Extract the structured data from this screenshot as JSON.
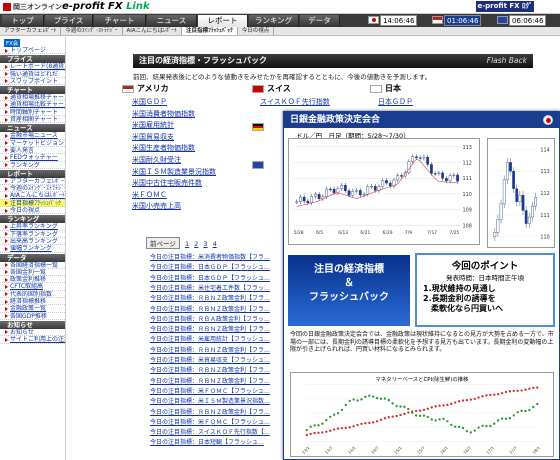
{
  "header": {
    "company": "岡三オンライン",
    "brand_prefix": "e-profit FX ",
    "brand_suffix": "Link",
    "clock1": "14:06:46",
    "clock2": "01:06:46",
    "clock3": "06:06:46",
    "fx_link": "e-profit FX ﾛｸﾞｱｳﾄ"
  },
  "nav": [
    "トップ",
    "プライス",
    "チャート",
    "ニュース",
    "レポート",
    "ランキング",
    "データ"
  ],
  "active_tab": "レポート",
  "subnav": [
    "アフターカフェﾚﾎﾟｰﾄ",
    "今週のｽｲﾝｸﾞ･ｽﾄﾗﾃｼﾞｰ",
    "AIAこんにちはﾚﾎﾟｰﾄ",
    "注目指標ﾌﾗｯｼｭﾊﾞｯｸ",
    "今日の視点"
  ],
  "sidebar": {
    "logo_text": "FX会",
    "sections": [
      {
        "title": "",
        "items": [
          "トップページ"
        ]
      },
      {
        "title": "プライス",
        "items": [
          "レートボード(8通貨)",
          "強い通貨はどれだ",
          "スワップポイント"
        ]
      },
      {
        "title": "チャート",
        "items": [
          "通貨相場推移チャート",
          "通貨相場比較チャート",
          "時間軸別チャート",
          "資産相関チャート"
        ]
      },
      {
        "title": "ニュース",
        "items": [
          "金融市場ニュース",
          "マーケットビジョン",
          "要人発言",
          "FEDウォッチャー",
          "ランキング"
        ]
      },
      {
        "title": "レポート",
        "items": [
          "アフターカフェﾚﾎﾟｰﾄ",
          "今週のｽｲﾝｸﾞ･ｽﾄﾗﾃｼﾞｰ",
          "AIAこんにちはﾚﾎﾟｰﾄ",
          "注目指標ﾌﾗｯｼｭﾊﾞｯｸ",
          "今日の視点"
        ]
      },
      {
        "title": "ランキング",
        "items": [
          "上昇率ランキング",
          "下落率ランキング",
          "出来高ランキング",
          "値幅ランキング"
        ]
      },
      {
        "title": "データ",
        "items": [
          "各国経済指標一覧",
          "各国金利一覧",
          "政策金利推移",
          "CFTC取組高",
          "代表的国別指数",
          "経済指標推移",
          "金融政策一覧",
          "各国GDP推移"
        ]
      },
      {
        "title": "お知らせ",
        "items": [
          "お知らせ",
          "サイトご利用上の注意"
        ]
      }
    ],
    "highlighted": "注目指標ﾌﾗｯｼｭﾊﾞｯｸ"
  },
  "main": {
    "title": "注目の経済指標・フラッシュバック",
    "title_right": "Flash Back",
    "description": "前回、結果発表後にどのような値動きをみせたかを再確認するとともに、今後の値動きを予測します。",
    "countries": [
      {
        "name": "アメリカ",
        "items": [
          "米国ＧＤＰ",
          "米国消費者物価指数",
          "米国雇用統計",
          "米国貿易収支",
          "米国生産者物価指数",
          "米国耐久財受注",
          "米国ＩＳＭ製造業景況指数",
          "米国中古住宅販売件数",
          "米ＦＯＭＣ",
          "米国小売売上高"
        ]
      },
      {
        "name": "スイス",
        "items": [
          "スイスＫＯＦ先行指数"
        ]
      },
      {
        "name": "日本",
        "items": [
          "日本ＧＤＰ",
          "日本短観"
        ]
      }
    ],
    "pager": {
      "prev": "前ページ",
      "pages": [
        "1",
        "2",
        "3",
        "4"
      ]
    },
    "archive": [
      "今日の注目指標：米消費者物価指数【フラ…",
      "今日の注目指標：日本ＧＤＰ【フラッシュ…",
      "今日の注目指標：日本ＧＤＰ【フラッシュ…",
      "今日の注目指標：米住宅着工件数【フラッ…",
      "今日の注目指標：ＲＢＮＺ政策金利【フラ…",
      "今日の注目指標：ＲＢＮＺ政策金利【フラ…",
      "今日の注目指標：ＲＢＡ政策金利【フラッ…",
      "今日の注目指標：ＲＢＮＺ政策金利【フラ…",
      "今日の注目指標：米雇用統計【フラッシュ…",
      "今日の注目指標：ＲＢＮＺ政策金利【フラ…",
      "今日の注目指標：米貿易収支【フラッシュ…",
      "今日の注目指標：ＲＢＮＺ政策金利【フラ…",
      "今日の注目指標：ＲＢＮＺ政策金利【フラ…",
      "今日の注目指標：米ＦＯＭＣ【フラッシュ…",
      "今日の注目指標：米ＩＳＭ製造業景況指数…",
      "今日の注目指標：ＲＢＮＺ政策金利【フラ…",
      "今日の注目指標：米ＦＯＭＣ【フラッシュ…",
      "今日の注目指標：スイスＫＯＦ先行指数【…",
      "今日の注目指標：日本短観【フラッシュ…"
    ]
  },
  "popup": {
    "title": "日銀金融政策決定会合",
    "subtitle": "ドル／円　日足（期間：5/28～7/30）",
    "banner": [
      "注目の経済指標",
      "＆",
      "フラッシュバック"
    ],
    "point_title": "今回のポイント",
    "point_sub": "発表時間：日本時間正午頃",
    "points": [
      "1.現状維持の見通し",
      "2.長期金利の誘導を",
      "　柔軟化なら円買いへ"
    ],
    "body": "今回の日銀金融政策決定会合では、金融政策は現状維持になるとの見方が大勢を占める一方で、市場の一部には、長期金利の誘導目標の柔軟化を予想する見方も出ています。長期金利の変動幅の上限が引き上げられれば、円買い材料になるとみられます。",
    "chart3_title": "マネタリーベースとCPI(除生鮮)の推移",
    "chart1_ylabels": [
      "113",
      "112",
      "111",
      "110",
      "109",
      "108"
    ],
    "chart1_xlabels": [
      "5/28",
      "6/5",
      "6/13",
      "6/21",
      "6/29",
      "7/9",
      "7/17",
      "7/25"
    ],
    "chart2_ylabels": [
      "114",
      "113",
      "112",
      "111",
      "110"
    ],
    "chart3_xlabels": [
      "13/1",
      "13/7",
      "14/1",
      "14/7",
      "15/1",
      "15/7",
      "16/1",
      "16/7",
      "17/1",
      "17/7",
      "18/1"
    ]
  },
  "chart_data": [
    {
      "type": "line",
      "title": "",
      "x": [
        "5/28",
        "6/5",
        "6/13",
        "6/21",
        "6/29",
        "7/9",
        "7/17",
        "7/25",
        "7/30"
      ],
      "series": [
        {
          "values": [
            109.5,
            109.8,
            110.4,
            110.0,
            110.5,
            110.9,
            112.6,
            111.1,
            111.0
          ]
        }
      ],
      "ylim": [
        108,
        113
      ]
    },
    {
      "type": "line",
      "title": "",
      "x": [
        "13/1",
        "13/7",
        "14/1",
        "14/7",
        "15/1",
        "15/7",
        "16/1",
        "16/7",
        "17/1",
        "17/7",
        "18/1"
      ],
      "series": [
        {
          "values": [
            100,
            135,
            170,
            210,
            260,
            300,
            340,
            380,
            420,
            450,
            475
          ]
        },
        {
          "values": [
            -0.4,
            0.2,
            1.2,
            1.4,
            0.9,
            0.3,
            0.1,
            -0.5,
            -0.1,
            0.4,
            0.9
          ]
        }
      ]
    }
  ],
  "colors": {
    "nav": "#3a3a3a",
    "popup": "#1b3d8f",
    "banner": "#1e56bf",
    "link": "#1133aa"
  }
}
